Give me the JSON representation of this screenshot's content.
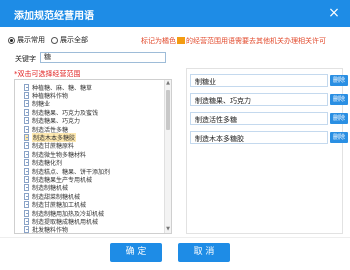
{
  "dialog": {
    "title": "添加规范经营用语",
    "close_glyph": "×"
  },
  "mode": {
    "option1": "展示常用",
    "option2": "展示全部",
    "selected": "展示常用"
  },
  "note": {
    "before": "标记为橘色",
    "after": "的经营范围用语需要去其他机关办理相关许可",
    "highlight_color": "#f39c12"
  },
  "search": {
    "label": "关键字",
    "value": "糖"
  },
  "hint": "*双击可选择经营范围",
  "list": {
    "items": [
      "种植糖、麻、糖、糖草",
      "种植糖料作物",
      "制糖业",
      "制造糖果、巧克力及蜜饯",
      "制造糖果、巧克力",
      "制造活性多糖",
      "制造木本多糖胶",
      "制造甘蔗糖原料",
      "制造微生物多糖材料",
      "制造糖化剂",
      "制造糕点、糖果、饼干添加剂",
      "制造糖果生产专用机械",
      "制造制糖机械",
      "制造甜菜制糖机械",
      "制造甘蔗糖加工机械",
      "制造制糖用加热及冷却机械",
      "制造提取糖成糖机用机械",
      "批发糖料作物"
    ],
    "selected_index": 6
  },
  "selected": {
    "items": [
      "制糖业",
      "制造糖果、巧克力",
      "制造活性多糖",
      "制造木本多糖胶"
    ],
    "delete_label": "删除"
  },
  "buttons": {
    "ok": "确 定",
    "cancel": "取 消"
  },
  "colors": {
    "accent": "#1e8ce6",
    "warning": "#e24a2c",
    "hint": "#e02020"
  }
}
